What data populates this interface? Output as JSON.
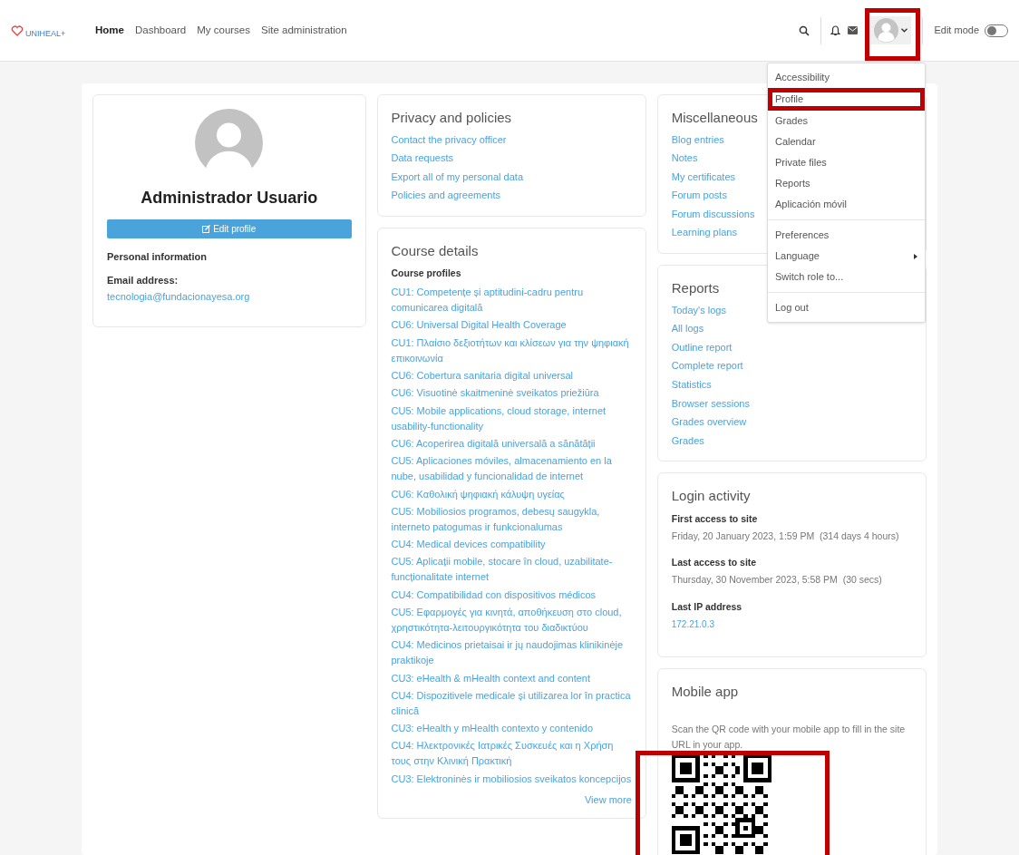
{
  "header": {
    "logo": "UNIHEAL+",
    "nav": [
      {
        "label": "Home",
        "selected": true
      },
      {
        "label": "Dashboard",
        "selected": false
      },
      {
        "label": "My courses",
        "selected": false
      },
      {
        "label": "Site administration",
        "selected": false
      }
    ],
    "user_menu": {
      "expanded": true,
      "highlighted": true
    },
    "edit_mode": {
      "label": "Edit mode",
      "on": false
    }
  },
  "dropdown": {
    "groups": [
      [
        {
          "label": "Accessibility",
          "highlighted": false
        },
        {
          "label": "Profile",
          "highlighted": true
        },
        {
          "label": "Grades",
          "highlighted": false
        },
        {
          "label": "Calendar",
          "highlighted": false
        },
        {
          "label": "Private files",
          "highlighted": false
        },
        {
          "label": "Reports",
          "highlighted": false
        },
        {
          "label": "Aplicación móvil",
          "highlighted": false
        }
      ],
      [
        {
          "label": "Preferences",
          "highlighted": false
        },
        {
          "label": "Language",
          "highlighted": false,
          "submenu": true
        },
        {
          "label": "Switch role to...",
          "highlighted": false
        }
      ],
      [
        {
          "label": "Log out",
          "highlighted": false
        }
      ]
    ]
  },
  "profile": {
    "name": "Administrador Usuario",
    "edit_button": "Edit profile",
    "section": "Personal information",
    "field_label": "Email address:",
    "email": "tecnologia@fundacionayesa.org"
  },
  "privacy": {
    "title": "Privacy and policies",
    "links": [
      "Contact the privacy officer",
      "Data requests",
      "Export all of my personal data",
      "Policies and agreements"
    ]
  },
  "course_details": {
    "title": "Course details",
    "subtitle": "Course profiles",
    "courses": [
      "CU1: Competențe și aptitudini-cadru pentru comunicarea digitală",
      "CU6: Universal Digital Health Coverage",
      "CU1: Πλαίσιο δεξιοτήτων και κλίσεων για την ψηφιακή επικοινωνία",
      "CU6: Cobertura sanitaria digital universal",
      "CU6: Visuotinė skaitmeninė sveikatos priežiūra",
      "CU5: Mobile applications, cloud storage, internet usability-functionality",
      "CU6: Acoperirea digitală universală a sănătății",
      "CU5: Aplicaciones móviles, almacenamiento en la nube, usabilidad y funcionalidad de internet",
      "CU6: Καθολική ψηφιακή κάλυψη υγείας",
      "CU5: Mobiliosios programos, debesų saugykla, interneto patogumas ir funkcionalumas",
      "CU4: Medical devices compatibility",
      "CU5: Aplicații mobile, stocare în cloud, uzabilitate-funcționalitate internet",
      "CU4: Compatibilidad con dispositivos médicos",
      "CU5: Εφαρμογές για κινητά, αποθήκευση στο cloud, χρηστικότητα-λειτουργικότητα του διαδικτύου",
      "CU4: Medicinos prietaisai ir jų naudojimas klinikinėje praktikoje",
      "CU3: eHealth & mHealth context and content",
      "CU4: Dispozitivele medicale și utilizarea lor în practica clinică",
      "CU3: eHealth y mHealth contexto y contenido",
      "CU4: Ηλεκτρονικές Ιατρικές Συσκευές και η Χρήση τους στην Κλινική Πρακτική",
      "CU3: Elektroninės ir mobiliosios sveikatos koncepcijos"
    ],
    "view_more": "View more"
  },
  "miscellaneous": {
    "title": "Miscellaneous",
    "links": [
      "Blog entries",
      "Notes",
      "My certificates",
      "Forum posts",
      "Forum discussions",
      "Learning plans"
    ]
  },
  "reports": {
    "title": "Reports",
    "links": [
      "Today's logs",
      "All logs",
      "Outline report",
      "Complete report",
      "Statistics",
      "Browser sessions",
      "Grades overview",
      "Grades"
    ]
  },
  "login_activity": {
    "title": "Login activity",
    "entries": [
      {
        "label": "First access to site",
        "value": "Friday, 20 January 2023, 1:59 PM  (314 days 4 hours)",
        "kind": "text"
      },
      {
        "label": "Last access to site",
        "value": "Thursday, 30 November 2023, 5:58 PM  (30 secs)",
        "kind": "text"
      },
      {
        "label": "Last IP address",
        "value": "172.21.0.3",
        "kind": "link"
      }
    ]
  },
  "mobile_app": {
    "title": "Mobile app",
    "instructions": "Scan the QR code with your mobile app to fill in the site URL in your app.",
    "qr_highlighted": true
  }
}
